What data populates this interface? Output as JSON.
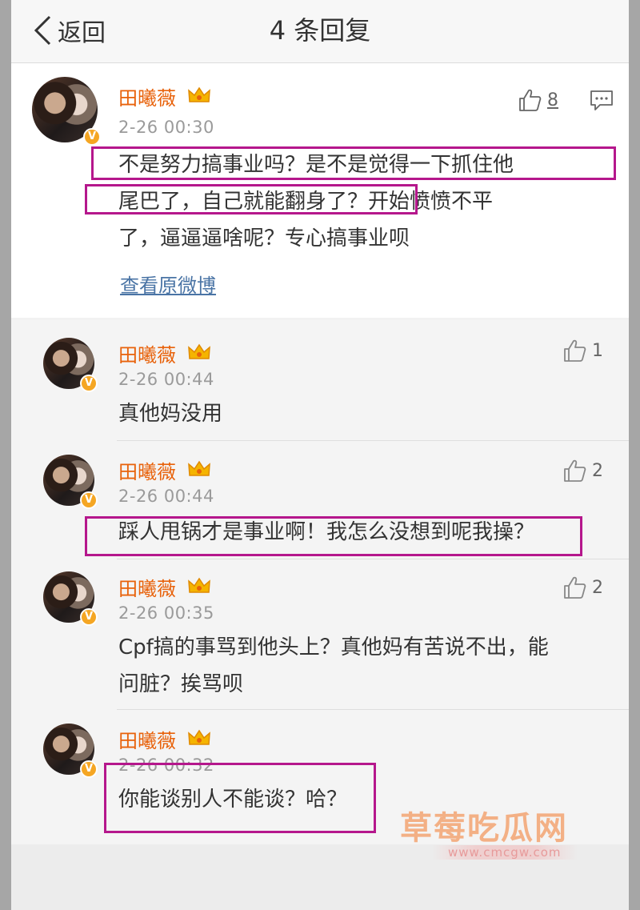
{
  "nav": {
    "back_label": "返回",
    "title": "4 条回复"
  },
  "main_comment": {
    "user": "田曦薇",
    "time": "2-26 00:30",
    "text_lines": [
      "不是努力搞事业吗？是不是觉得一下抓住他",
      "尾巴了，自己就能翻身了？开始愤愤不平",
      "了，逼逼逼啥呢？专心搞事业呗"
    ],
    "likes": "8",
    "view_original": "查看原微博"
  },
  "replies": [
    {
      "user": "田曦薇",
      "time": "2-26 00:44",
      "text_lines": [
        "真他妈没用"
      ],
      "likes": "1"
    },
    {
      "user": "田曦薇",
      "time": "2-26 00:44",
      "text_lines": [
        "踩人甩锅才是事业啊！我怎么没想到呢我操？"
      ],
      "likes": "2"
    },
    {
      "user": "田曦薇",
      "time": "2-26 00:35",
      "text_lines": [
        "Cpf搞的事骂到他头上？真他妈有苦说不出，能",
        "问脏？挨骂呗"
      ],
      "likes": "2"
    },
    {
      "user": "田曦薇",
      "time": "2-26 00:32",
      "text_lines": [
        "你能谈别人不能谈？哈？"
      ],
      "likes": ""
    }
  ],
  "watermark": {
    "title": "草莓吃瓜网",
    "url": "www.cmcgw.com"
  },
  "colors": {
    "username": "#e8620b",
    "highlight": "#b5178c",
    "link": "#4a74a5",
    "badge": "#f5a623"
  },
  "icons": [
    "chevron-left-icon",
    "crown-icon",
    "verified-badge-icon",
    "thumb-up-icon",
    "comment-icon"
  ]
}
